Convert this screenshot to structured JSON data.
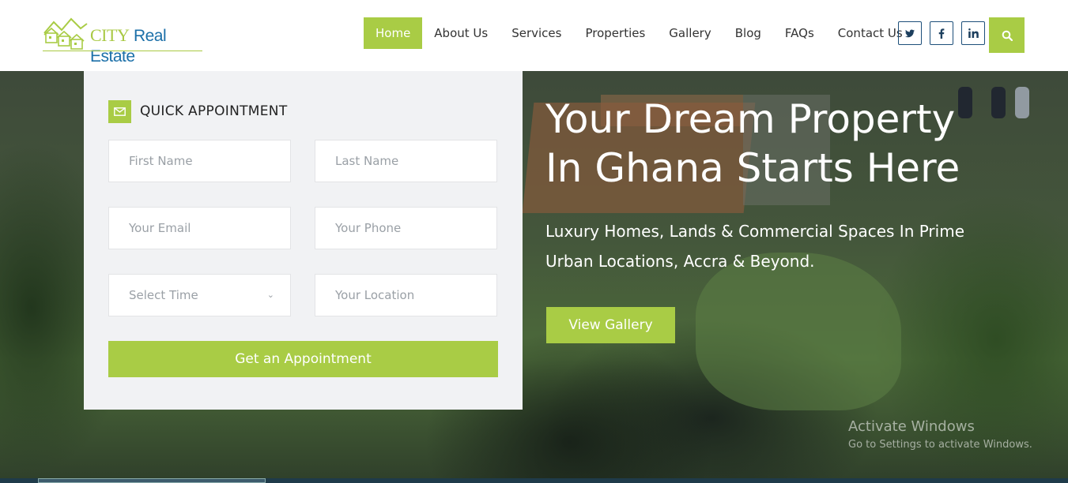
{
  "brand": {
    "logo_city": "CITY",
    "logo_rest": "Real Estate",
    "accent_color": "#a9cc45",
    "blue_color": "#1b6fa8"
  },
  "nav": {
    "items": [
      {
        "label": "Home",
        "active": true
      },
      {
        "label": "About Us"
      },
      {
        "label": "Services"
      },
      {
        "label": "Properties"
      },
      {
        "label": "Gallery"
      },
      {
        "label": "Blog"
      },
      {
        "label": "FAQs"
      },
      {
        "label": "Contact Us"
      }
    ],
    "social": [
      {
        "icon": "twitter-icon",
        "glyph": "t"
      },
      {
        "icon": "facebook-icon",
        "glyph": "f"
      },
      {
        "icon": "linkedin-icon",
        "glyph": "in"
      }
    ],
    "search_icon": "search-icon"
  },
  "appointment": {
    "title": "QUICK APPOINTMENT",
    "title_icon": "envelope-icon",
    "first_name_placeholder": "First Name",
    "last_name_placeholder": "Last Name",
    "email_placeholder": "Your Email",
    "phone_placeholder": "Your Phone",
    "time_select": "Select Time",
    "location_placeholder": "Your Location",
    "submit_label": "Get an Appointment"
  },
  "hero": {
    "title_line1": "Your Dream Property",
    "title_line2": "In Ghana Starts Here",
    "subtitle_line1": "Luxury Homes, Lands & Commercial Spaces In Prime",
    "subtitle_line2": "Urban Locations, Accra & Beyond.",
    "button_label": "View Gallery"
  },
  "watermark": {
    "title": "Activate Windows",
    "subtitle": "Go to Settings to activate Windows."
  }
}
